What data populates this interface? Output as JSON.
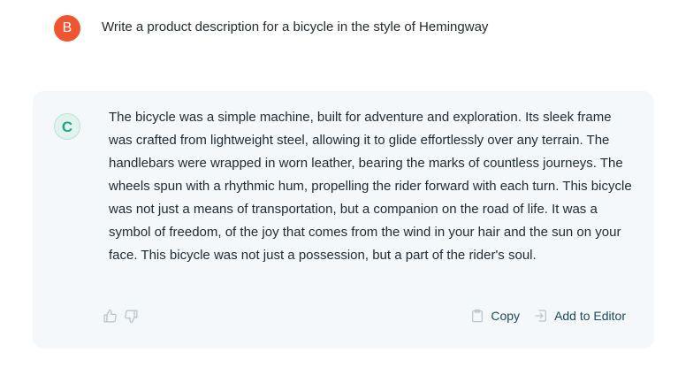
{
  "user_message": {
    "avatar_initial": "B",
    "avatar_color": "#f1552f",
    "text": "Write a product description for a bicycle in the style of Hemingway"
  },
  "assistant_message": {
    "avatar_initial": "C",
    "avatar_color": "#1fa58a",
    "text": "The bicycle was a simple machine, built for adventure and exploration. Its sleek frame was crafted from lightweight steel, allowing it to glide effortlessly over any terrain. The handlebars were wrapped in worn leather, bearing the marks of countless journeys. The wheels spun with a rhythmic hum, propelling the rider forward with each turn. This bicycle was not just a means of transportation, but a companion on the road of life. It was a symbol of freedom, of the joy that comes from the wind in your hair and the sun on your face. This bicycle was not just a possession, but a part of the rider's soul."
  },
  "actions": {
    "copy_label": "Copy",
    "add_to_editor_label": "Add to Editor"
  },
  "icons": {
    "thumbs_up": "thumbs-up-icon",
    "thumbs_down": "thumbs-down-icon",
    "copy": "clipboard-icon",
    "add_to_editor": "insert-icon"
  },
  "colors": {
    "card_background": "#f4f8fa",
    "action_text": "#1b4a5a",
    "icon_muted": "#b9c3c8"
  }
}
